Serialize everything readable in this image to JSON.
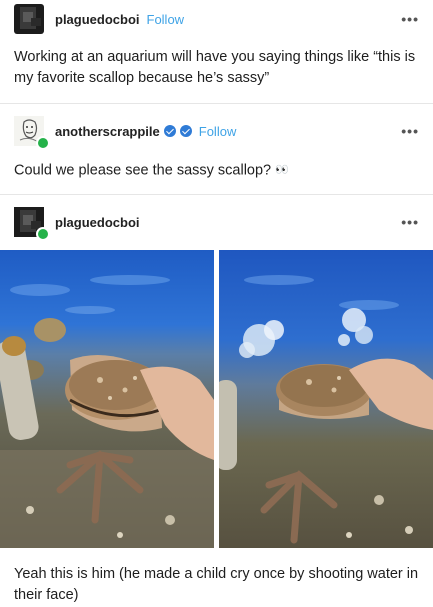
{
  "post1": {
    "username": "plaguedocboi",
    "follow_label": "Follow",
    "more": "•••",
    "text": "Working at an aquarium will have you saying things like “this is my favorite scallop because he’s sassy”"
  },
  "post2": {
    "username": "anotherscrappile",
    "follow_label": "Follow",
    "more": "•••",
    "text": "Could we please see the sassy scallop?",
    "emoji": "👀"
  },
  "post3": {
    "username": "plaguedocboi",
    "more": "•••",
    "caption": "Yeah this is him (he made a child cry once by shooting water in their face)"
  },
  "colors": {
    "follow": "#3fa3e6",
    "online_badge": "#25b24a",
    "verified": "#2f7bd6"
  },
  "icons": [
    "more-icon",
    "verified-icon",
    "online-badge-icon",
    "eyes-emoji"
  ]
}
